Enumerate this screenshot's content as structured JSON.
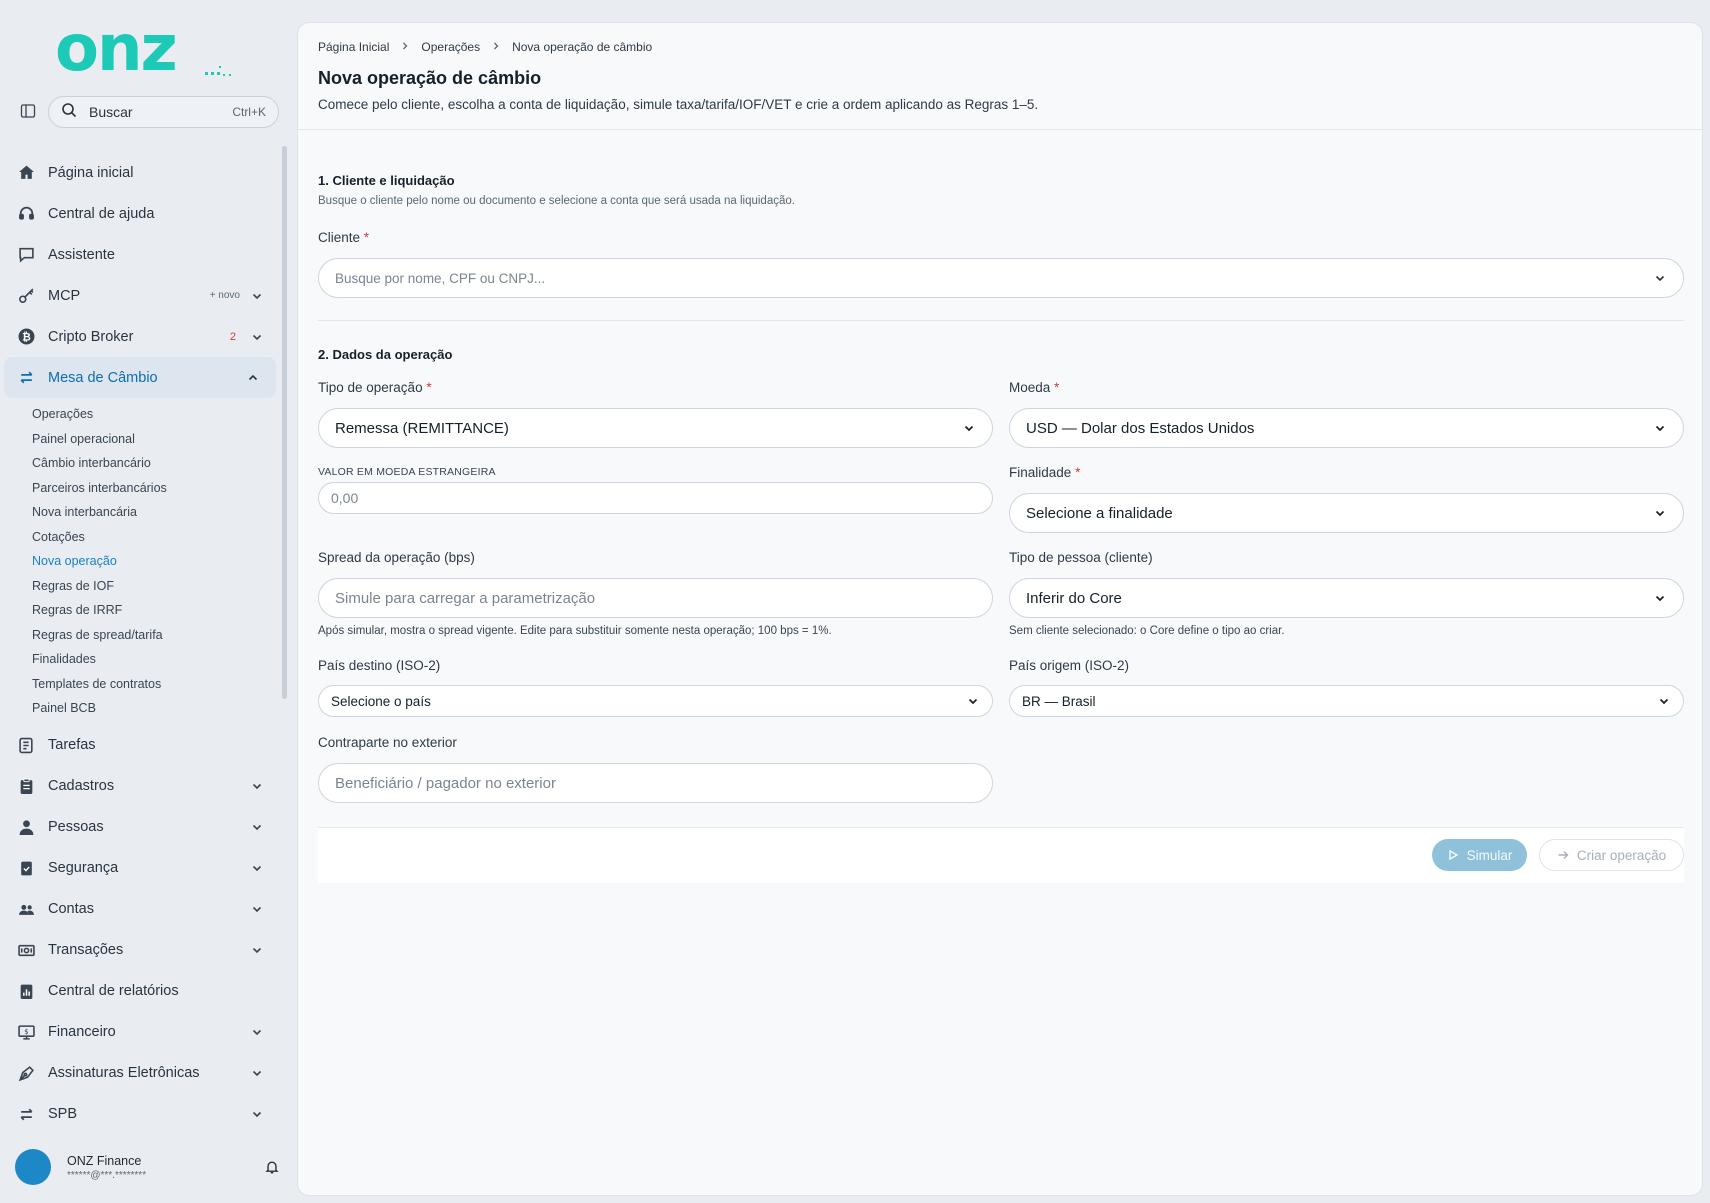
{
  "brand": {
    "logo_text": "onz",
    "accent": "#1dc9b7"
  },
  "search": {
    "label": "Buscar",
    "shortcut": "Ctrl+K"
  },
  "sidebar": {
    "items": [
      {
        "label": "Página inicial",
        "icon": "home-icon"
      },
      {
        "label": "Central de ajuda",
        "icon": "headset-icon"
      },
      {
        "label": "Assistente",
        "icon": "chat-icon"
      },
      {
        "label": "MCP",
        "icon": "key-icon",
        "badge": "+ novo"
      },
      {
        "label": "Cripto Broker",
        "icon": "bitcoin-icon",
        "badge": "2"
      },
      {
        "label": "Mesa de Câmbio",
        "icon": "exchange-icon"
      }
    ],
    "sub_items": [
      "Operações",
      "Painel operacional",
      "Câmbio interbancário",
      "Parceiros interbancários",
      "Nova interbancária",
      "Cotações",
      "Nova operação",
      "Regras de IOF",
      "Regras de IRRF",
      "Regras de spread/tarifa",
      "Finalidades",
      "Templates de contratos",
      "Painel BCB"
    ],
    "items_after": [
      {
        "label": "Tarefas",
        "icon": "tasks-icon"
      },
      {
        "label": "Cadastros",
        "icon": "clipboard-icon"
      },
      {
        "label": "Pessoas",
        "icon": "person-icon"
      },
      {
        "label": "Segurança",
        "icon": "shield-icon"
      },
      {
        "label": "Contas",
        "icon": "people-icon"
      },
      {
        "label": "Transações",
        "icon": "money-icon"
      },
      {
        "label": "Central de relatórios",
        "icon": "report-icon"
      },
      {
        "label": "Financeiro",
        "icon": "finance-icon"
      },
      {
        "label": "Assinaturas Eletrônicas",
        "icon": "signature-icon"
      },
      {
        "label": "SPB",
        "icon": "transfer-icon"
      }
    ]
  },
  "user": {
    "name": "ONZ Finance",
    "email": "******@***.********"
  },
  "breadcrumb": [
    "Página Inicial",
    "Operações",
    "Nova operação de câmbio"
  ],
  "page": {
    "title": "Nova operação de câmbio",
    "subtitle": "Comece pelo cliente, escolha a conta de liquidação, simule taxa/tarifa/IOF/VET e crie a ordem aplicando as Regras 1–5."
  },
  "section1": {
    "title": "1. Cliente e liquidação",
    "desc": "Busque o cliente pelo nome ou documento e selecione a conta que será usada na liquidação.",
    "client_label": "Cliente",
    "client_placeholder": "Busque por nome, CPF ou CNPJ..."
  },
  "section2": {
    "title": "2. Dados da operação",
    "tipo_label": "Tipo de operação",
    "tipo_value": "Remessa (REMITTANCE)",
    "moeda_label": "Moeda",
    "moeda_value": "USD — Dolar dos Estados Unidos",
    "valor_label": "VALOR EM MOEDA ESTRANGEIRA",
    "valor_placeholder": "0,00",
    "finalidade_label": "Finalidade",
    "finalidade_value": "Selecione a finalidade",
    "spread_label": "Spread da operação (bps)",
    "spread_placeholder": "Simule para carregar a parametrização",
    "spread_hint": "Após simular, mostra o spread vigente. Edite para substituir somente nesta operação; 100 bps = 1%.",
    "pessoa_label": "Tipo de pessoa (cliente)",
    "pessoa_value": "Inferir do Core",
    "pessoa_hint": "Sem cliente selecionado: o Core define o tipo ao criar.",
    "destino_label": "País destino (ISO-2)",
    "destino_value": "Selecione o país",
    "origem_label": "País origem (ISO-2)",
    "origem_value": "BR — Brasil",
    "contraparte_label": "Contraparte no exterior",
    "contraparte_placeholder": "Beneficiário / pagador no exterior"
  },
  "actions": {
    "simulate": "Simular",
    "create": "Criar operação"
  }
}
